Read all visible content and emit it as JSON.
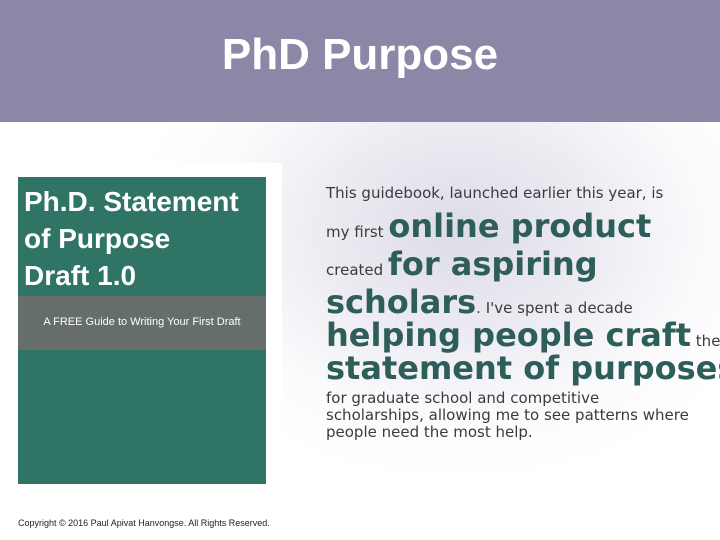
{
  "slide": {
    "title": "PhD Purpose"
  },
  "book_cover": {
    "title_lines": [
      "Ph.D. Statement",
      "of Purpose",
      "Draft 1.0"
    ],
    "subtitle": "A FREE Guide to Writing Your First Draft",
    "copyright": "Copyright © 2016 Paul Apivat Hanvongse. All Rights Reserved."
  },
  "description": {
    "line1": "This guidebook, launched earlier this year, is",
    "line2_pre": "my first ",
    "line2_big": "online product",
    "line3_pre": "created ",
    "line3_big": "for aspiring",
    "line4_big": "scholars",
    "line4_post": ". I've spent a decade",
    "line5_big": "helping people craft",
    "line5_post": " their",
    "line6_big": "statement of purposes",
    "line7": "for graduate school and competitive",
    "line8": "scholarships, allowing me to see patterns where",
    "line9": "people need the most help."
  },
  "colors": {
    "title_bar": "#8b87a7",
    "cover_green": "#2f7465",
    "cover_band": "#656e6b",
    "emphasis_text": "#2e5e5a"
  }
}
